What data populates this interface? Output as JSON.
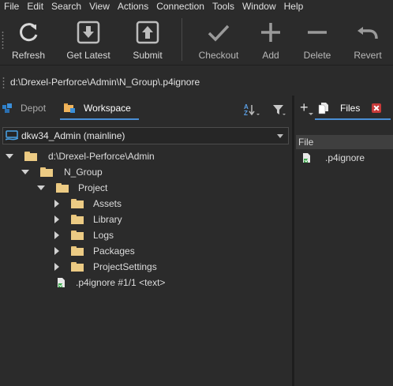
{
  "menu": [
    "File",
    "Edit",
    "Search",
    "View",
    "Actions",
    "Connection",
    "Tools",
    "Window",
    "Help"
  ],
  "toolbar": {
    "refresh": "Refresh",
    "get_latest": "Get Latest",
    "submit": "Submit",
    "checkout": "Checkout",
    "add": "Add",
    "delete": "Delete",
    "revert": "Revert"
  },
  "path": "d:\\Drexel-Perforce\\Admin\\N_Group\\.p4ignore",
  "tabs": {
    "depot": "Depot",
    "workspace": "Workspace"
  },
  "workspace_selector": "dkw34_Admin (mainline)",
  "tree": {
    "root": "d:\\Drexel-Perforce\\Admin",
    "group": "N_Group",
    "project": "Project",
    "folders": [
      "Assets",
      "Library",
      "Logs",
      "Packages",
      "ProjectSettings"
    ],
    "file": ".p4ignore #1/1 <text>"
  },
  "files_panel": {
    "tab": "Files",
    "column": "File",
    "items": [
      ".p4ignore"
    ]
  },
  "colors": {
    "accent": "#4a8fd6",
    "folder": "#eccb84",
    "close": "#c83a3a"
  }
}
